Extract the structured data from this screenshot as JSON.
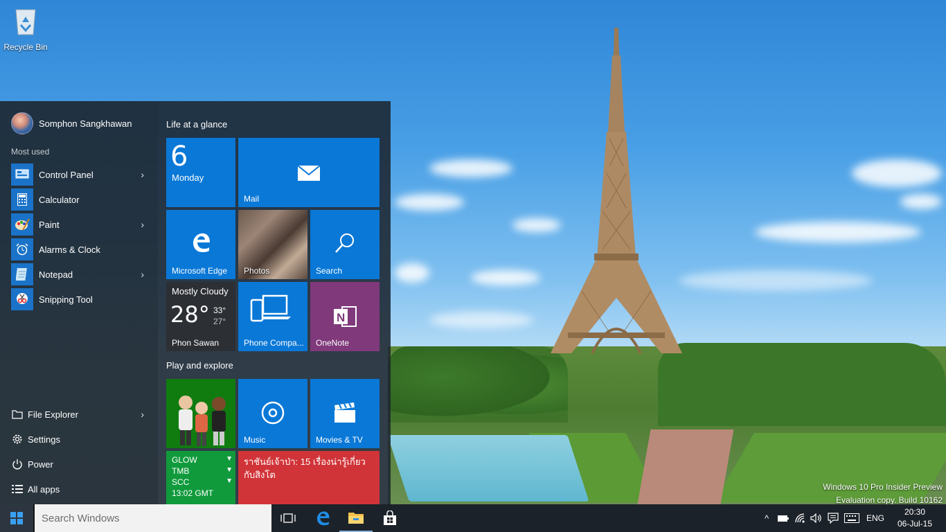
{
  "desktop": {
    "recycle_bin_label": "Recycle Bin",
    "watermark_line1": "Windows 10 Pro Insider Preview",
    "watermark_line2": "Evaluation copy. Build 10162"
  },
  "start_menu": {
    "user_name": "Somphon Sangkhawan",
    "most_used_label": "Most used",
    "apps": [
      {
        "label": "Control Panel",
        "icon": "control-panel-icon",
        "has_submenu": true
      },
      {
        "label": "Calculator",
        "icon": "calculator-icon",
        "has_submenu": false
      },
      {
        "label": "Paint",
        "icon": "paint-icon",
        "has_submenu": true
      },
      {
        "label": "Alarms & Clock",
        "icon": "alarm-clock-icon",
        "has_submenu": false
      },
      {
        "label": "Notepad",
        "icon": "notepad-icon",
        "has_submenu": true
      },
      {
        "label": "Snipping Tool",
        "icon": "scissors-icon",
        "has_submenu": false
      }
    ],
    "bottom": [
      {
        "label": "File Explorer",
        "icon": "folder-icon",
        "has_submenu": true
      },
      {
        "label": "Settings",
        "icon": "gear-icon",
        "has_submenu": false
      },
      {
        "label": "Power",
        "icon": "power-icon",
        "has_submenu": false
      },
      {
        "label": "All apps",
        "icon": "list-icon",
        "has_submenu": false
      }
    ],
    "groups": {
      "life": "Life at a glance",
      "play": "Play and explore"
    },
    "tiles": {
      "calendar": {
        "day": "6",
        "weekday": "Monday"
      },
      "mail": "Mail",
      "edge": "Microsoft Edge",
      "photos": "Photos",
      "search": "Search",
      "weather": {
        "condition": "Mostly Cloudy",
        "temp": "28°",
        "high": "33°",
        "low": "27°",
        "location": "Phon Sawan"
      },
      "phone": "Phone Compa...",
      "onenote": "OneNote",
      "music": "Music",
      "movies": "Movies & TV",
      "stocks": [
        {
          "symbol": "GLOW",
          "arrow": "▼"
        },
        {
          "symbol": "TMB",
          "arrow": "▼"
        },
        {
          "symbol": "SCC",
          "arrow": "▼"
        }
      ],
      "stocks_time": "13:02 GMT",
      "news": "ราชันย์เจ้าป่า: 15 เรื่องน่ารู้เกี่ยวกับสิงโต"
    }
  },
  "taskbar": {
    "search_placeholder": "Search Windows",
    "language": "ENG",
    "time": "20:30",
    "date": "06-Jul-15"
  },
  "colors": {
    "tile_blue": "#0a78d7",
    "onenote_purple": "#80397b",
    "xbox_green": "#107c10",
    "money_green": "#109a3c",
    "news_red": "#d13438",
    "taskbar": "#1c2229"
  }
}
